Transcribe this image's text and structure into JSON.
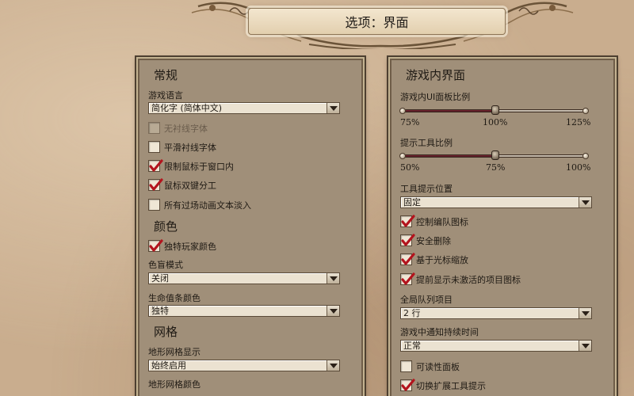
{
  "window": {
    "title": "选项：界面"
  },
  "general": {
    "heading": "常规",
    "language_label": "游戏语言",
    "language_value": "简化字 (简体中文)",
    "checkboxes": [
      {
        "label": "无衬线字体",
        "checked": false,
        "enabled": false
      },
      {
        "label": "平滑衬线字体",
        "checked": false,
        "enabled": true
      },
      {
        "label": "限制鼠标于窗口内",
        "checked": true,
        "enabled": true
      },
      {
        "label": "鼠标双键分工",
        "checked": true,
        "enabled": true
      },
      {
        "label": "所有过场动画文本淡入",
        "checked": false,
        "enabled": true
      }
    ]
  },
  "colors": {
    "heading": "颜色",
    "unique_player_color_label": "独特玩家颜色",
    "unique_player_color_checked": true,
    "colorblind_label": "色盲模式",
    "colorblind_value": "关闭",
    "health_bar_label": "生命值条颜色",
    "health_bar_value": "独特"
  },
  "grid": {
    "heading": "网格",
    "terrain_grid_label": "地形网格显示",
    "terrain_grid_value": "始终启用",
    "terrain_grid_color_label": "地形网格颜色"
  },
  "ingame": {
    "heading": "游戏内界面",
    "ui_scale": {
      "label": "游戏内UI面板比例",
      "ticks": [
        "75%",
        "100%",
        "125%"
      ],
      "value_percent": 100,
      "min_percent": 75,
      "max_percent": 125
    },
    "tooltip_scale": {
      "label": "提示工具比例",
      "ticks": [
        "50%",
        "75%",
        "100%"
      ],
      "value_percent": 75,
      "min_percent": 50,
      "max_percent": 100
    },
    "tooltip_position_label": "工具提示位置",
    "tooltip_position_value": "固定",
    "checkboxes": [
      {
        "label": "控制编队图标",
        "checked": true
      },
      {
        "label": "安全删除",
        "checked": true
      },
      {
        "label": "基于光标缩放",
        "checked": true
      },
      {
        "label": "提前显示未激活的项目图标",
        "checked": true
      }
    ],
    "global_queue_label": "全局队列项目",
    "global_queue_value": "2 行",
    "notification_duration_label": "游戏中通知持续时间",
    "notification_duration_value": "正常",
    "checkboxes_bottom": [
      {
        "label": "可读性面板",
        "checked": false
      },
      {
        "label": "切换扩展工具提示",
        "checked": true
      }
    ]
  },
  "colors_palette": {
    "check_red": "#b3141d",
    "slider_fill": "#6e2430",
    "panel_bg": "#a08f79"
  }
}
